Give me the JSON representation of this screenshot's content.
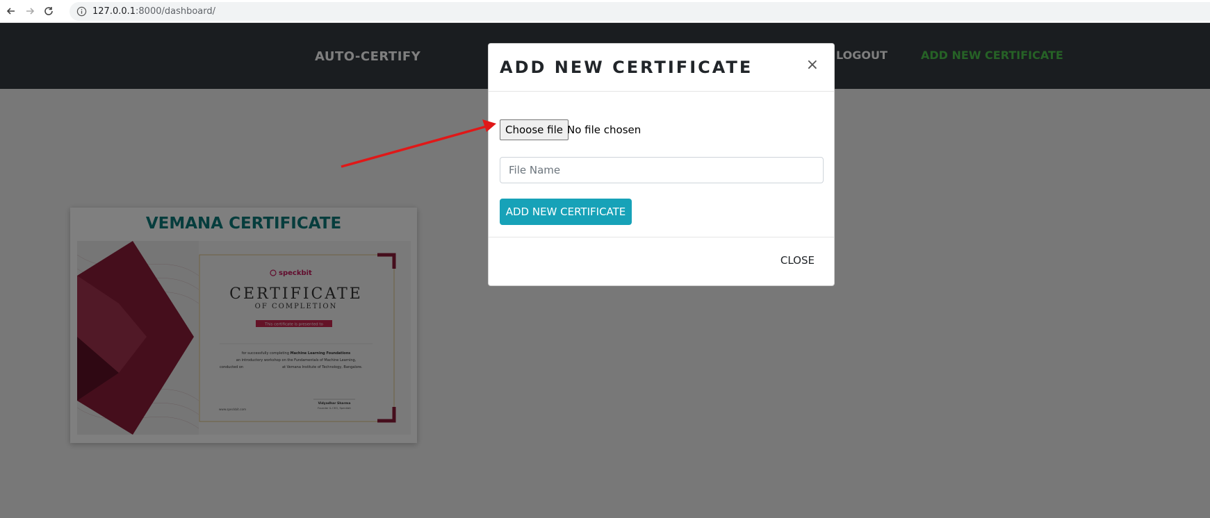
{
  "browser": {
    "url_host": "127.0.0.1",
    "url_path": ":8000/dashboard/"
  },
  "navbar": {
    "brand": "AUTO-CERTIFY",
    "logout": "LOGOUT",
    "add_certificate": "ADD NEW CERTIFICATE"
  },
  "card": {
    "title": "VEMANA CERTIFICATE",
    "certificate": {
      "logo": "speckbit",
      "heading": "CERTIFICATE",
      "subheading": "OF COMPLETION",
      "presented": "This certificate is presented to",
      "body_line1_a": "for successfully completing ",
      "body_line1_b": "Machine Learning Foundations",
      "body_line2": "an introductory workshop on the Fundamentals of Machine Learning,",
      "body_line3_a": "conducted on",
      "body_line3_b": "at Vemana Institute of Technology, Bangalore.",
      "website": "www.speckbit.com",
      "signer": "Vidyadhar Sharma",
      "signer_role": "Founder & CEO, Speckbit"
    }
  },
  "modal": {
    "title": "ADD NEW CERTIFICATE",
    "close_x": "×",
    "file_button": "Choose file",
    "file_status": "No file chosen",
    "file_name_placeholder": "File Name",
    "submit": "ADD NEW CERTIFICATE",
    "close": "CLOSE"
  },
  "colors": {
    "navbar_bg": "#343a40",
    "accent_green": "#4cc44c",
    "button_teal": "#17a2b8",
    "card_title": "#0d7a7a",
    "arrow": "#e01818"
  }
}
